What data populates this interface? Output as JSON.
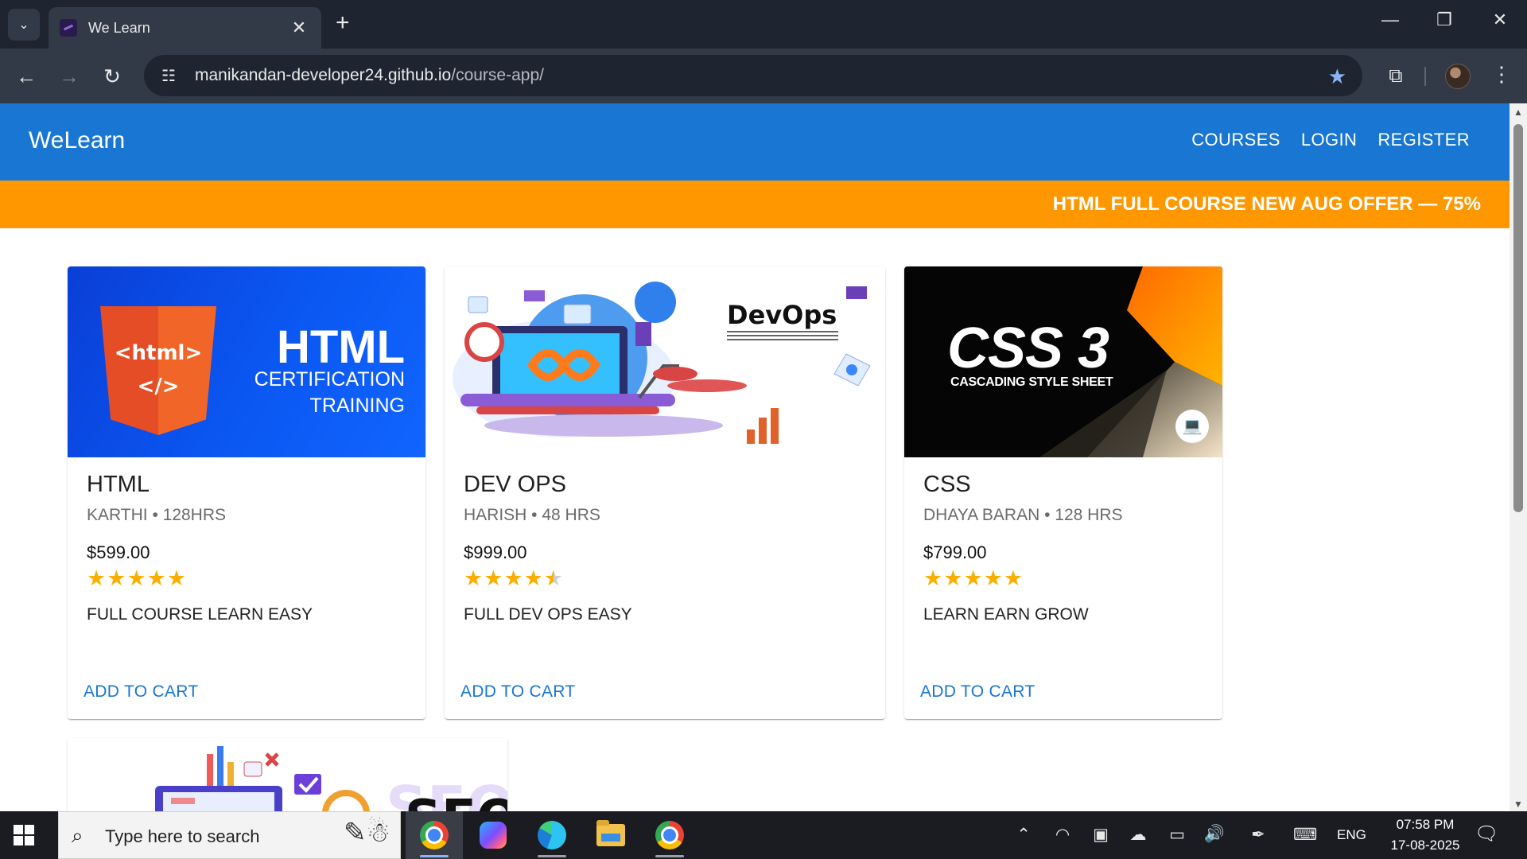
{
  "browser": {
    "tab_title": "We Learn",
    "url_host": "manikandan-developer24.github.io",
    "url_path": "/course-app/"
  },
  "app": {
    "brand": "WeLearn",
    "nav": [
      "COURSES",
      "LOGIN",
      "REGISTER"
    ],
    "offer": "HTML FULL COURSE NEW AUG OFFER — 75%"
  },
  "courses": [
    {
      "title": "HTML",
      "subtitle": "KARTHI • 128HRS",
      "price": "$599.00",
      "rating": 5,
      "description": "FULL COURSE LEARN EASY",
      "action": "ADD TO CART",
      "image": {
        "tag": "<html>",
        "tag_close": "</>",
        "heading": "HTML",
        "line1": "CERTIFICATION",
        "line2": "TRAINING"
      }
    },
    {
      "title": "DEV OPS",
      "subtitle": "HARISH • 48 HRS",
      "price": "$999.00",
      "rating": 4.5,
      "description": "FULL DEV OPS EASY",
      "action": "ADD TO CART",
      "image": {
        "heading": "DevOps"
      }
    },
    {
      "title": "CSS",
      "subtitle": "DHAYA BARAN • 128 HRS",
      "price": "$799.00",
      "rating": 5,
      "description": "LEARN EARN GROW",
      "action": "ADD TO CART",
      "image": {
        "heading": "CSS 3",
        "line1": "CASCADING STYLE SHEET"
      }
    },
    {
      "image": {
        "heading": "SEO"
      }
    }
  ],
  "taskbar": {
    "search_placeholder": "Type here to search",
    "language": "ENG",
    "time": "07:58 PM",
    "date": "17-08-2025"
  },
  "icons": {
    "tab_menu": "chevron-down-icon",
    "back": "arrow-left-icon",
    "forward": "arrow-right-icon",
    "reload": "reload-icon",
    "bookmark": "star-icon",
    "extensions": "puzzle-icon",
    "menu": "kebab-icon"
  },
  "colors": {
    "primary": "#1976d2",
    "offer": "#ff9800",
    "star": "#faaf00"
  }
}
